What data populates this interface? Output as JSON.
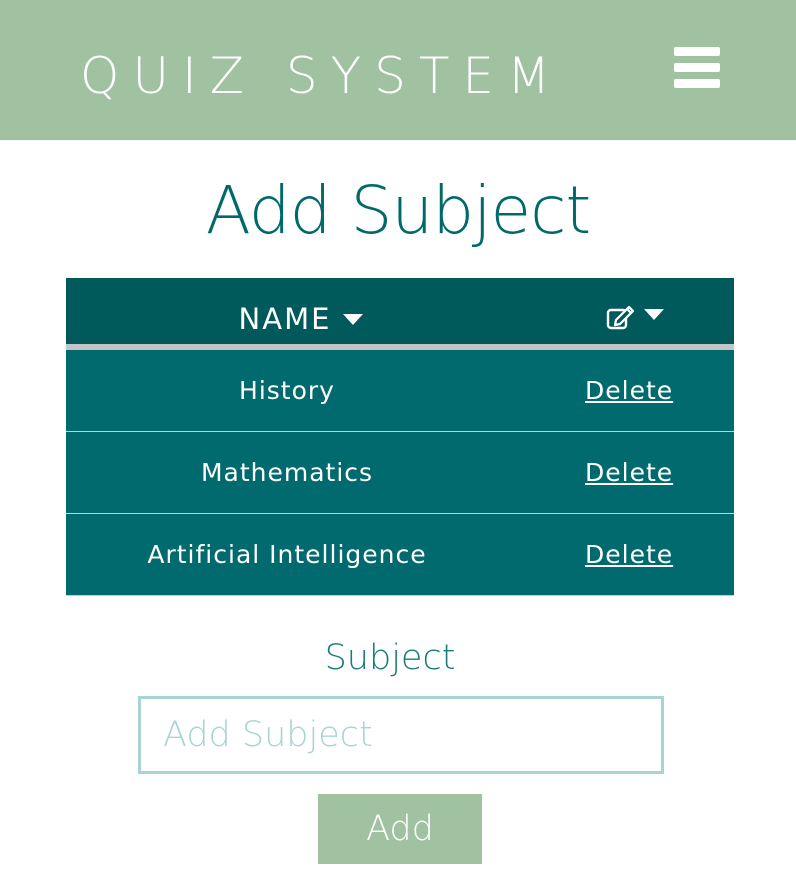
{
  "header": {
    "brand": "QUIZ SYSTEM",
    "menu_icon": "hamburger-menu-icon"
  },
  "page": {
    "title": "Add Subject"
  },
  "table": {
    "columns": {
      "name": "NAME",
      "action_icon": "edit-icon"
    },
    "rows": [
      {
        "name": "History",
        "action": "Delete"
      },
      {
        "name": "Mathematics",
        "action": "Delete"
      },
      {
        "name": "Artificial Intelligence",
        "action": "Delete"
      }
    ]
  },
  "form": {
    "label": "Subject",
    "input_placeholder": "Add Subject",
    "input_value": "",
    "submit_label": "Add"
  },
  "colors": {
    "header_bg": "#a0c2a0",
    "title": "#006a6a",
    "table_head": "#005a5c",
    "table_row": "#006a6e",
    "input_border": "#a8d4d4"
  }
}
